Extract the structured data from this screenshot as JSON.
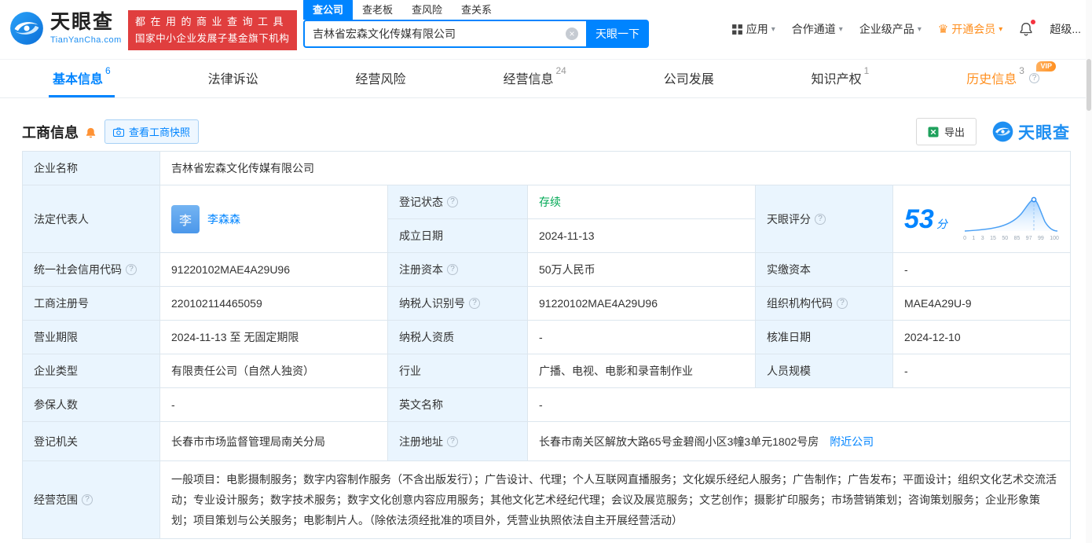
{
  "brand": {
    "name": "天眼查",
    "domain": "TianYanCha.com",
    "slogan_line1": "都在用的商业查询工具",
    "slogan_line2": "国家中小企业发展子基金旗下机构"
  },
  "search": {
    "tabs": [
      {
        "label": "查公司"
      },
      {
        "label": "查老板"
      },
      {
        "label": "查风险"
      },
      {
        "label": "查关系"
      }
    ],
    "value": "吉林省宏森文化传媒有限公司",
    "button": "天眼一下"
  },
  "nav": {
    "apps": "应用",
    "partner": "合作通道",
    "enterprise": "企业级产品",
    "vip": "开通会员",
    "super": "超级..."
  },
  "tabs": [
    {
      "label": "基本信息",
      "count": "6"
    },
    {
      "label": "法律诉讼",
      "count": ""
    },
    {
      "label": "经营风险",
      "count": ""
    },
    {
      "label": "经营信息",
      "count": "24"
    },
    {
      "label": "公司发展",
      "count": ""
    },
    {
      "label": "知识产权",
      "count": "1"
    },
    {
      "label": "历史信息",
      "count": "3",
      "vip": "VIP"
    }
  ],
  "section": {
    "title": "工商信息",
    "snapshot": "查看工商快照",
    "export": "导出",
    "brand": "天眼查"
  },
  "score": {
    "value": "53",
    "unit": "分",
    "ticks": [
      "0",
      "1",
      "3",
      "15",
      "50",
      "85",
      "97",
      "99",
      "100"
    ]
  },
  "fields": {
    "company_name_label": "企业名称",
    "company_name": "吉林省宏森文化传媒有限公司",
    "legal_rep_label": "法定代表人",
    "legal_rep_avatar": "李",
    "legal_rep_name": "李森森",
    "reg_status_label": "登记状态",
    "reg_status": "存续",
    "score_label": "天眼评分",
    "est_date_label": "成立日期",
    "est_date": "2024-11-13",
    "credit_code_label": "统一社会信用代码",
    "credit_code": "91220102MAE4A29U96",
    "reg_capital_label": "注册资本",
    "reg_capital": "50万人民币",
    "paid_capital_label": "实缴资本",
    "paid_capital": "-",
    "reg_no_label": "工商注册号",
    "reg_no": "220102114465059",
    "taxpayer_no_label": "纳税人识别号",
    "taxpayer_no": "91220102MAE4A29U96",
    "org_code_label": "组织机构代码",
    "org_code": "MAE4A29U-9",
    "term_label": "营业期限",
    "term": "2024-11-13 至 无固定期限",
    "taxpayer_quality_label": "纳税人资质",
    "taxpayer_quality": "-",
    "approval_date_label": "核准日期",
    "approval_date": "2024-12-10",
    "type_label": "企业类型",
    "type": "有限责任公司（自然人独资）",
    "industry_label": "行业",
    "industry": "广播、电视、电影和录音制作业",
    "staff_label": "人员规模",
    "staff": "-",
    "insured_label": "参保人数",
    "insured": "-",
    "en_name_label": "英文名称",
    "en_name": "-",
    "authority_label": "登记机关",
    "authority": "长春市市场监督管理局南关分局",
    "address_label": "注册地址",
    "address": "长春市南关区解放大路65号金碧阁小区3幢3单元1802号房",
    "nearby": "附近公司",
    "scope_label": "经营范围",
    "scope": "一般项目：电影摄制服务；数字内容制作服务（不含出版发行）；广告设计、代理；个人互联网直播服务；文化娱乐经纪人服务；广告制作；广告发布；平面设计；组织文化艺术交流活动；专业设计服务；数字技术服务；数字文化创意内容应用服务；其他文化艺术经纪代理；会议及展览服务；文艺创作；摄影扩印服务；市场营销策划；咨询策划服务；企业形象策划；项目策划与公关服务；电影制片人。（除依法须经批准的项目外，凭营业执照依法自主开展经营活动）"
  },
  "icons": {
    "help": "?",
    "caret": "▾",
    "crown": "♛",
    "clear": "×"
  }
}
